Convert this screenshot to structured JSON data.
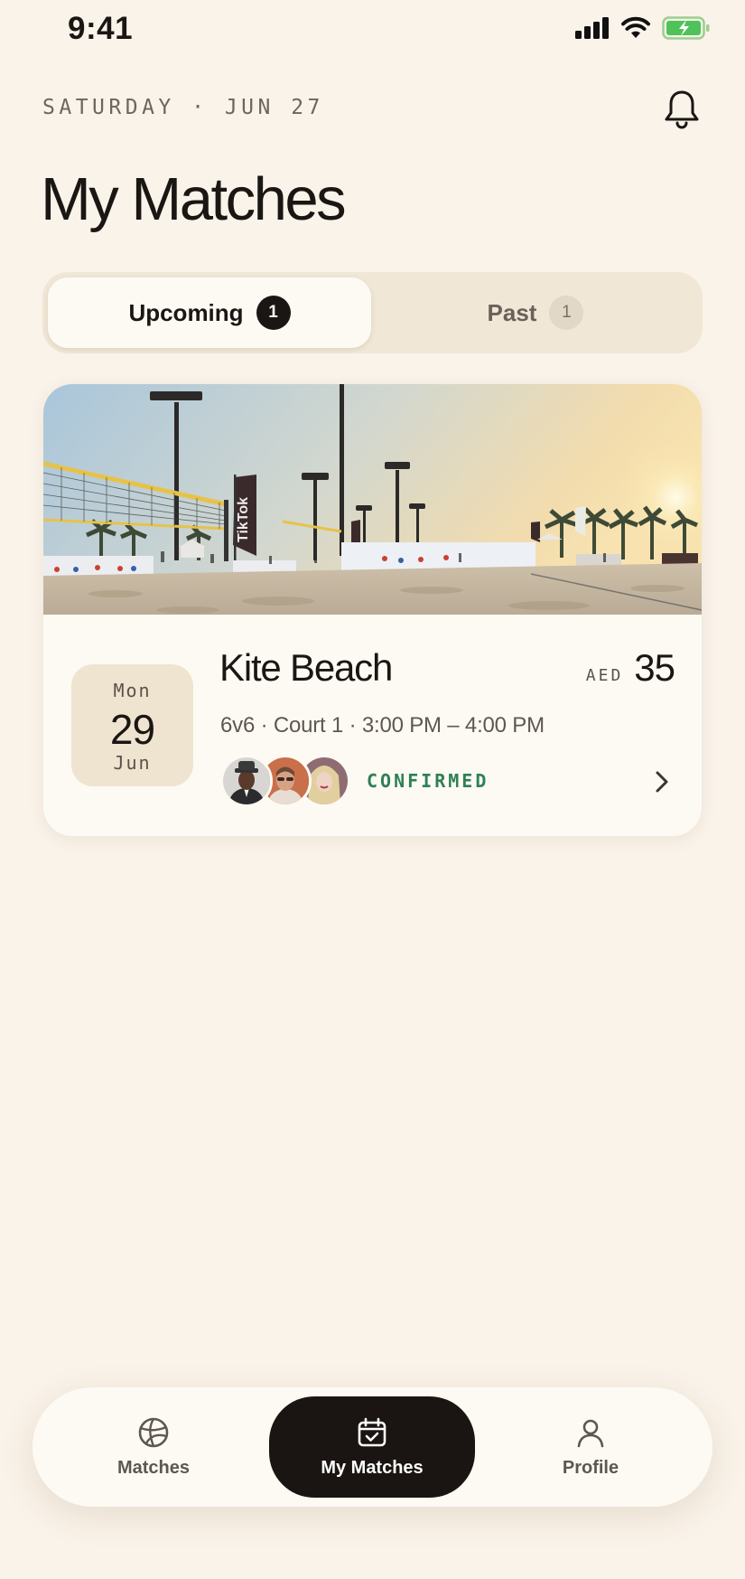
{
  "status_bar": {
    "time": "9:41"
  },
  "header": {
    "date_line": "SATURDAY · JUN 27",
    "title": "My Matches"
  },
  "tabs": [
    {
      "label": "Upcoming",
      "count": "1",
      "active": true
    },
    {
      "label": "Past",
      "count": "1",
      "active": false
    }
  ],
  "match": {
    "date": {
      "dow": "Mon",
      "day": "29",
      "month": "Jun"
    },
    "venue": "Kite Beach",
    "price": {
      "currency": "AED",
      "amount": "35"
    },
    "details": "6v6 · Court 1 · 3:00 PM – 4:00 PM",
    "status": "CONFIRMED",
    "banner_text": "TikTok"
  },
  "nav": {
    "items": [
      {
        "label": "Matches",
        "icon": "volleyball-icon",
        "active": false
      },
      {
        "label": "My Matches",
        "icon": "calendar-check-icon",
        "active": true
      },
      {
        "label": "Profile",
        "icon": "person-icon",
        "active": false
      }
    ]
  },
  "colors": {
    "background": "#faf3e9",
    "accent_dark": "#1a1512",
    "confirmed": "#2e8055"
  }
}
